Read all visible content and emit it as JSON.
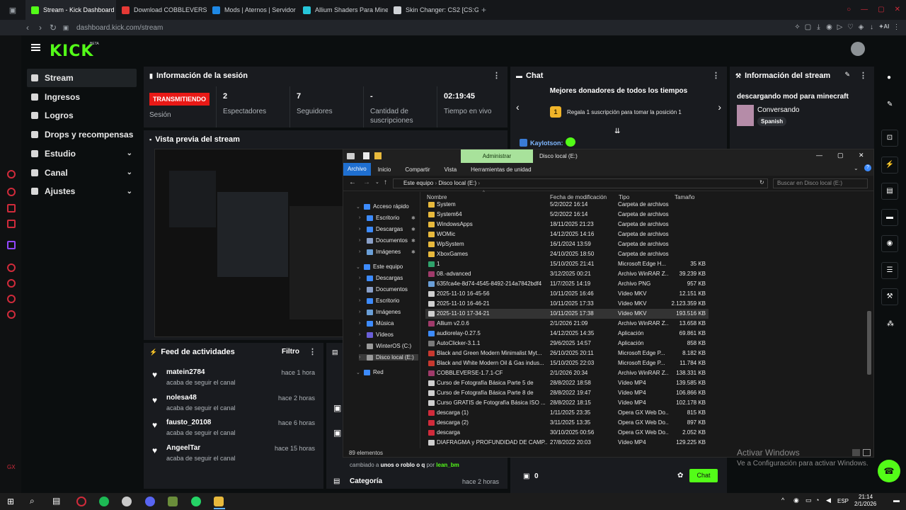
{
  "browser": {
    "tabs": [
      {
        "label": "Stream - Kick Dashboard",
        "color": "#53fc18"
      },
      {
        "label": "Download COBBLEVERSE",
        "color": "#e53935"
      },
      {
        "label": "Mods | Aternos | Servidor",
        "color": "#1e88e5"
      },
      {
        "label": "Allium Shaders Para Mine",
        "color": "#26c6da"
      },
      {
        "label": "Skin Changer: CS2 [CS:GO",
        "color": "#cfd2d6"
      }
    ],
    "url": "dashboard.kick.com/stream"
  },
  "kick": {
    "logo": "KICK",
    "beta": "BETA",
    "sidebar": [
      {
        "label": "Stream",
        "active": true,
        "chev": false
      },
      {
        "label": "Ingresos",
        "active": false,
        "chev": false
      },
      {
        "label": "Logros",
        "active": false,
        "chev": false
      },
      {
        "label": "Drops y recompensas",
        "active": false,
        "chev": false
      },
      {
        "label": "Estudio",
        "active": false,
        "chev": true
      },
      {
        "label": "Canal",
        "active": false,
        "chev": true
      },
      {
        "label": "Ajustes",
        "active": false,
        "chev": true
      }
    ],
    "session": {
      "title": "Información de la sesión",
      "live_badge": "TRANSMITIENDO",
      "session_label": "Sesión",
      "stats": [
        {
          "value": "2",
          "label": "Espectadores"
        },
        {
          "value": "7",
          "label": "Seguidores"
        },
        {
          "value": "-",
          "label": "Cantidad de suscripciones"
        },
        {
          "value": "02:19:45",
          "label": "Tiempo en vivo"
        }
      ]
    },
    "chat": {
      "title": "Chat",
      "top_donors": "Mejores donadores de todos los tiempos",
      "rank": "1",
      "gift_text": "Regala 1 suscripción para tomar la posición 1",
      "chat_user": "Kaylotson:",
      "count": "0",
      "button": "Chat"
    },
    "stream_info": {
      "title": "Información del stream",
      "stream_title": "descargando mod para minecraft",
      "category": "Conversando",
      "language": "Spanish"
    },
    "preview": {
      "title": "Vista previa del stream"
    },
    "feed": {
      "title": "Feed de actividades",
      "filter": "Filtro",
      "items": [
        {
          "user": "matein2784",
          "action": "acaba de seguir el canal",
          "time": "hace 1 hora"
        },
        {
          "user": "nolesa48",
          "action": "acaba de seguir el canal",
          "time": "hace 2 horas"
        },
        {
          "user": "fausto_20108",
          "action": "acaba de seguir el canal",
          "time": "hace 6 horas"
        },
        {
          "user": "AngeelTar",
          "action": "acaba de seguir el canal",
          "time": "hace 15 horas"
        }
      ]
    },
    "events": {
      "change_prefix": "cambiado a",
      "change_value": "unos o roblo o q",
      "by": "por",
      "by_user": "lean_bm",
      "category_label": "Categoría",
      "category_time": "hace 2 horas"
    }
  },
  "explorer": {
    "admin_tab": "Administrar",
    "window_title": "Disco local (E:)",
    "ribbon": [
      "Archivo",
      "Inicio",
      "Compartir",
      "Vista",
      "Herramientas de unidad"
    ],
    "breadcrumb": [
      "Este equipo",
      "Disco local (E:)"
    ],
    "search_placeholder": "Buscar en Disco local (E:)",
    "columns": [
      "Nombre",
      "Fecha de modificación",
      "Tipo",
      "Tamaño"
    ],
    "tree": [
      {
        "label": "Acceso rápido",
        "level": 0,
        "pin": false
      },
      {
        "label": "Escritorio",
        "level": 1,
        "pin": true
      },
      {
        "label": "Descargas",
        "level": 1,
        "pin": true
      },
      {
        "label": "Documentos",
        "level": 1,
        "pin": true
      },
      {
        "label": "Imágenes",
        "level": 1,
        "pin": true
      },
      {
        "label": "Este equipo",
        "level": 0,
        "pin": false
      },
      {
        "label": "Descargas",
        "level": 1,
        "pin": false
      },
      {
        "label": "Documentos",
        "level": 1,
        "pin": false
      },
      {
        "label": "Escritorio",
        "level": 1,
        "pin": false
      },
      {
        "label": "Imágenes",
        "level": 1,
        "pin": false
      },
      {
        "label": "Música",
        "level": 1,
        "pin": false
      },
      {
        "label": "Vídeos",
        "level": 1,
        "pin": false
      },
      {
        "label": "WinterOS (C:)",
        "level": 1,
        "pin": false
      },
      {
        "label": "Disco local (E:)",
        "level": 1,
        "pin": false,
        "selected": true
      },
      {
        "label": "Red",
        "level": 0,
        "pin": false
      }
    ],
    "files": [
      {
        "name": "System",
        "date": "5/2/2022 16:14",
        "type": "Carpeta de archivos",
        "size": "",
        "icon": "#e8b93c"
      },
      {
        "name": "System64",
        "date": "5/2/2022 16:14",
        "type": "Carpeta de archivos",
        "size": "",
        "icon": "#e8b93c"
      },
      {
        "name": "WindowsApps",
        "date": "18/11/2025 21:23",
        "type": "Carpeta de archivos",
        "size": "",
        "icon": "#e8b93c"
      },
      {
        "name": "WOMic",
        "date": "14/12/2025 14:16",
        "type": "Carpeta de archivos",
        "size": "",
        "icon": "#e8b93c"
      },
      {
        "name": "WpSystem",
        "date": "16/1/2024 13:59",
        "type": "Carpeta de archivos",
        "size": "",
        "icon": "#e8b93c"
      },
      {
        "name": "XboxGames",
        "date": "24/10/2025 18:50",
        "type": "Carpeta de archivos",
        "size": "",
        "icon": "#e8b93c"
      },
      {
        "name": "1",
        "date": "15/10/2025 21:41",
        "type": "Microsoft Edge H...",
        "size": "35 KB",
        "icon": "#2fa36b"
      },
      {
        "name": "08.-advanced",
        "date": "3/12/2025 00:21",
        "type": "Archivo WinRAR Z...",
        "size": "39.239 KB",
        "icon": "#a03a6a"
      },
      {
        "name": "635fca4e-8d74-4545-8492-214a7842bdf4",
        "date": "11/7/2025 14:19",
        "type": "Archivo PNG",
        "size": "957 KB",
        "icon": "#6a9fd8"
      },
      {
        "name": "2025-11-10 16-45-56",
        "date": "10/11/2025 16:46",
        "type": "Vídeo MKV",
        "size": "12.151 KB",
        "icon": "#cfcfcf"
      },
      {
        "name": "2025-11-10 16-46-21",
        "date": "10/11/2025 17:33",
        "type": "Vídeo MKV",
        "size": "2.123.359 KB",
        "icon": "#cfcfcf"
      },
      {
        "name": "2025-11-10 17-34-21",
        "date": "10/11/2025 17:38",
        "type": "Vídeo MKV",
        "size": "193.516 KB",
        "icon": "#cfcfcf",
        "hl": true
      },
      {
        "name": "Allium v2.0.6",
        "date": "2/1/2026 21:09",
        "type": "Archivo WinRAR Z...",
        "size": "13.658 KB",
        "icon": "#a03a6a"
      },
      {
        "name": "audiorelay-0.27.5",
        "date": "14/12/2025 14:35",
        "type": "Aplicación",
        "size": "69.861 KB",
        "icon": "#3d8bfd"
      },
      {
        "name": "AutoClicker-3.1.1",
        "date": "29/6/2025 14:57",
        "type": "Aplicación",
        "size": "858 KB",
        "icon": "#7a7a7a"
      },
      {
        "name": "Black and Green Modern Minimalist Myt...",
        "date": "26/10/2025 20:11",
        "type": "Microsoft Edge P...",
        "size": "8.182 KB",
        "icon": "#c8382f"
      },
      {
        "name": "Black and White Modern Oil & Gas indus...",
        "date": "15/10/2025 22:03",
        "type": "Microsoft Edge P...",
        "size": "11.784 KB",
        "icon": "#c8382f"
      },
      {
        "name": "COBBLEVERSE-1.7.1-CF",
        "date": "2/1/2026 20:34",
        "type": "Archivo WinRAR Z...",
        "size": "138.331 KB",
        "icon": "#a03a6a"
      },
      {
        "name": "Curso de Fotografía Básica   Parte 5 de",
        "date": "28/8/2022 18:58",
        "type": "Vídeo MP4",
        "size": "139.585 KB",
        "icon": "#cfcfcf"
      },
      {
        "name": "Curso de Fotografía Básica   Parte 8 de",
        "date": "28/8/2022 19:47",
        "type": "Vídeo MP4",
        "size": "106.866 KB",
        "icon": "#cfcfcf"
      },
      {
        "name": "Curso GRATIS de Fotografía Básica   ISO ...",
        "date": "28/8/2022 18:15",
        "type": "Vídeo MP4",
        "size": "102.178 KB",
        "icon": "#cfcfcf"
      },
      {
        "name": "descarga (1)",
        "date": "1/11/2025 23:35",
        "type": "Opera GX Web Do...",
        "size": "815 KB",
        "icon": "#d12b3b"
      },
      {
        "name": "descarga (2)",
        "date": "3/11/2025 13:35",
        "type": "Opera GX Web Do...",
        "size": "897 KB",
        "icon": "#d12b3b"
      },
      {
        "name": "descarga",
        "date": "30/10/2025 00:56",
        "type": "Opera GX Web Do...",
        "size": "2.052 KB",
        "icon": "#d12b3b"
      },
      {
        "name": "DIAFRAGMA y PROFUNDIDAD DE CAMP...",
        "date": "27/8/2022 20:03",
        "type": "Vídeo MP4",
        "size": "129.225 KB",
        "icon": "#cfcfcf"
      }
    ],
    "status": "89 elementos",
    "activate": "Activar Windows",
    "activate_sub": "Ve a Configuración para activar Windows."
  },
  "taskbar": {
    "lang": "ESP",
    "time": "21:14",
    "date": "2/1/2026"
  }
}
